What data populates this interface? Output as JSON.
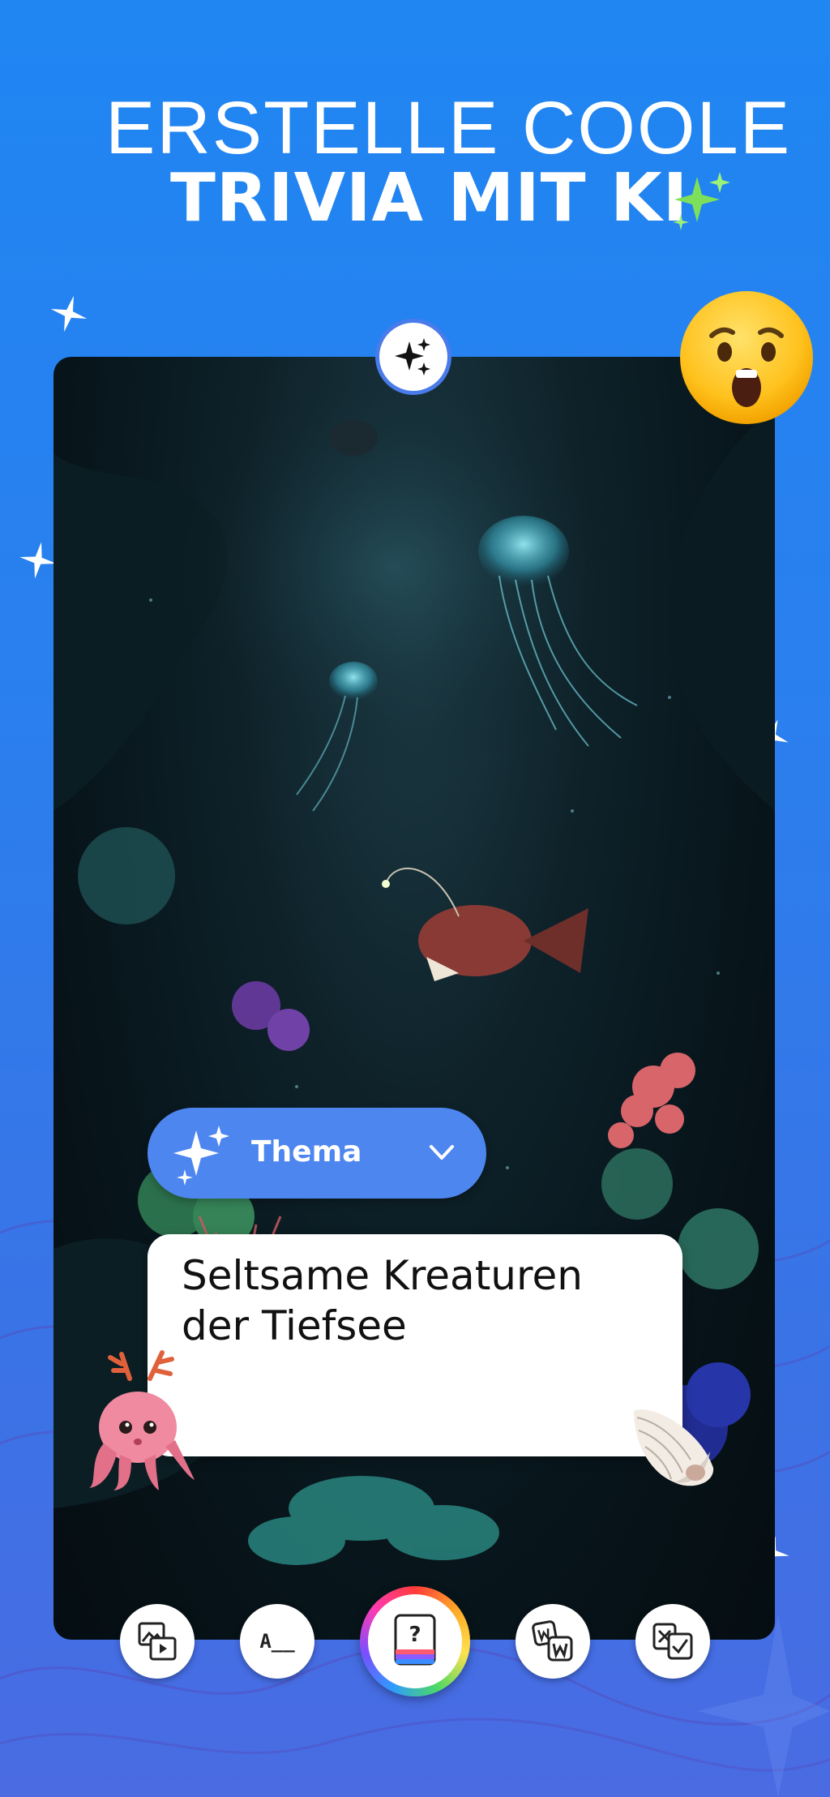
{
  "headline": {
    "line1": "ERSTELLE COOLE",
    "line2": "TRIVIA MIT KI"
  },
  "topic_selector": {
    "label": "Thema",
    "icon": "sparkles-icon",
    "chevron": "chevron-down-icon"
  },
  "topic_input": {
    "value": "Seltsame Kreaturen der Tiefsee"
  },
  "toolbar": {
    "items": [
      {
        "name": "image-video-icon"
      },
      {
        "name": "fill-in-blank-icon",
        "glyph": "A__"
      },
      {
        "name": "quiz-card-icon",
        "glyph": "?"
      },
      {
        "name": "word-tiles-icon"
      },
      {
        "name": "true-false-icon"
      }
    ]
  },
  "colors": {
    "background": "#2b7fee",
    "pill": "#4e86f0",
    "card_dark": "#07141a",
    "sparkle_green": "#7ee05a"
  }
}
